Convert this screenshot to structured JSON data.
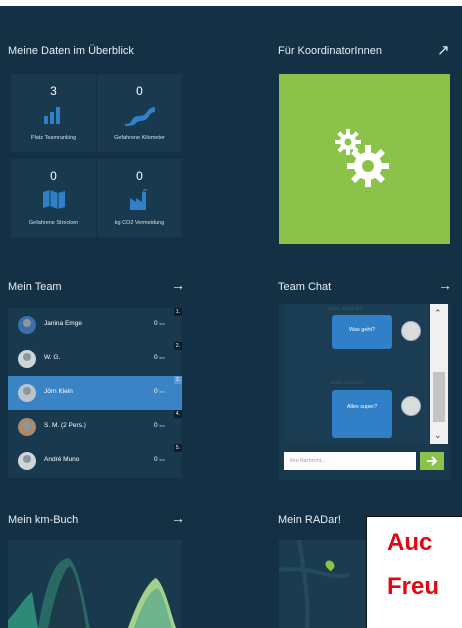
{
  "overview": {
    "title": "Meine Daten im Überblick",
    "tiles": [
      {
        "value": "3",
        "label": "Platz Teamranking",
        "icon": "bar-chart-icon"
      },
      {
        "value": "0",
        "label": "Gefahrene Kilometer",
        "icon": "road-icon"
      },
      {
        "value": "0",
        "label": "Gefahrene Strecken",
        "icon": "map-icon"
      },
      {
        "value": "0",
        "label": "kg CO2 Vermeidung",
        "icon": "factory-icon"
      }
    ]
  },
  "coordinator": {
    "title": "Für KoordinatorInnen",
    "arrow": "↗",
    "tile_color": "#8bc34a",
    "icon": "gears-icon"
  },
  "team": {
    "title": "Mein Team",
    "arrow": "→",
    "members": [
      {
        "name": "Janina Emge",
        "km": "0",
        "unit": "km",
        "rank": "1."
      },
      {
        "name": "W. G.",
        "km": "0",
        "unit": "km",
        "rank": "2."
      },
      {
        "name": "Jörn Klein",
        "km": "0",
        "unit": "km",
        "rank": "3."
      },
      {
        "name": "S. M. (2 Pers.)",
        "km": "0",
        "unit": "km",
        "rank": "4."
      },
      {
        "name": "André Muno",
        "km": "0",
        "unit": "km",
        "rank": "5."
      }
    ]
  },
  "chat": {
    "title": "Team Chat",
    "arrow": "→",
    "messages": [
      {
        "timestamp": "Heute, 16:23 Uhr",
        "text": "Was geht?"
      },
      {
        "timestamp": "Heute, 16:23 Uhr",
        "text": "Alles super?"
      }
    ],
    "input_placeholder": "Ihre Nachricht...",
    "send_icon": "send-arrow-icon"
  },
  "kmbuch": {
    "title": "Mein km-Buch",
    "arrow": "→"
  },
  "radar": {
    "title": "Mein RADar!"
  },
  "overlay": {
    "line1": "Auc",
    "line2": "Freu"
  },
  "colors": {
    "background": "#143044",
    "tile": "#19394e",
    "accent_blue": "#3a83c4",
    "accent_green": "#8bc34a",
    "overlay_red": "#e30613"
  }
}
